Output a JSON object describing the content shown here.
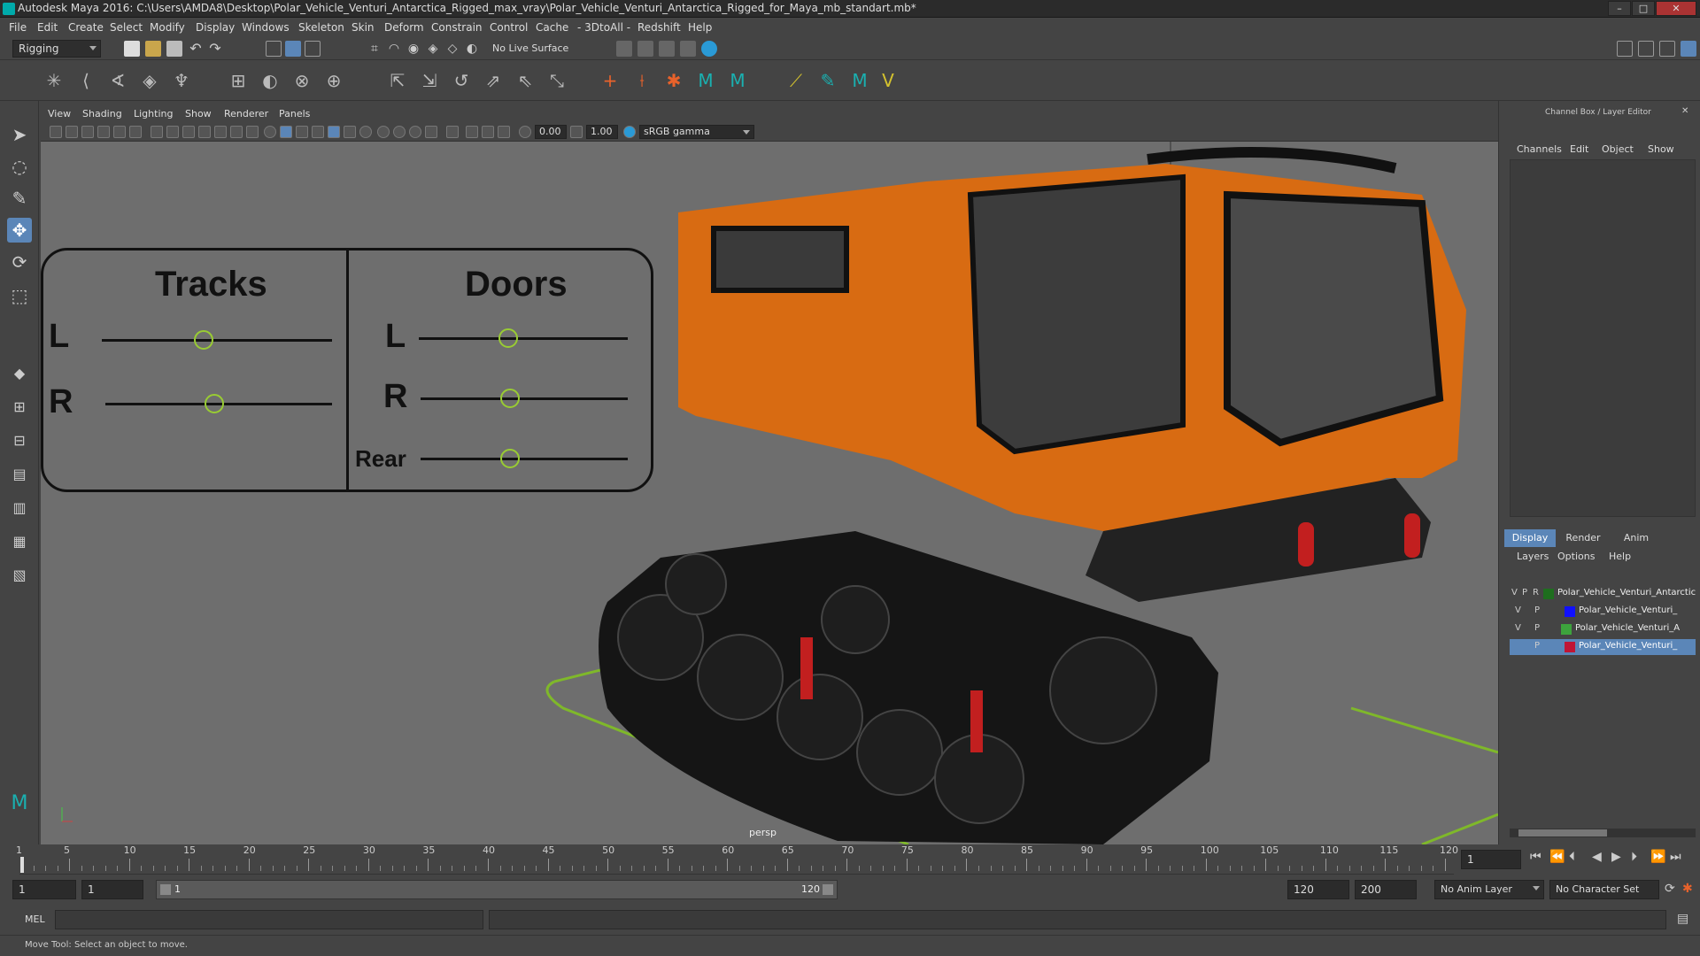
{
  "window": {
    "title": "Autodesk Maya 2016: C:\\Users\\AMDA8\\Desktop\\Polar_Vehicle_Venturi_Antarctica_Rigged_max_vray\\Polar_Vehicle_Venturi_Antarctica_Rigged_for_Maya_mb_standart.mb*",
    "minimize": "–",
    "maximize": "□",
    "close": "✕"
  },
  "menu": [
    "File",
    "Edit",
    "Create",
    "Select",
    "Modify",
    "Display",
    "Windows",
    "Skeleton",
    "Skin",
    "Deform",
    "Constrain",
    "Control",
    "Cache",
    "- 3DtoAll -",
    "Redshift",
    "Help"
  ],
  "statusline": {
    "menuset": "Rigging",
    "live_surface": "No Live Surface"
  },
  "viewport": {
    "menu": [
      "View",
      "Shading",
      "Lighting",
      "Show",
      "Renderer",
      "Panels"
    ],
    "exposure": "0.00",
    "gamma": "1.00",
    "colorspace": "sRGB gamma",
    "camera_label": "persp"
  },
  "control_panel": {
    "tracks_title": "Tracks",
    "doors_title": "Doors",
    "tracks_left": "L",
    "tracks_right": "R",
    "doors_left": "L",
    "doors_right": "R",
    "doors_rear": "Rear"
  },
  "channel_box": {
    "header": "Channel Box / Layer Editor",
    "menu": [
      "Channels",
      "Edit",
      "Object",
      "Show"
    ],
    "tabs": [
      "Display",
      "Render",
      "Anim"
    ],
    "layer_menu": [
      "Layers",
      "Options",
      "Help"
    ],
    "layers": [
      {
        "v": "V",
        "p": "P",
        "r": "R",
        "color": "#1e6e1e",
        "name": "Polar_Vehicle_Venturi_Antarctica"
      },
      {
        "v": "V",
        "p": "P",
        "r": "",
        "color": "#1010ff",
        "name": "Polar_Vehicle_Venturi_"
      },
      {
        "v": "V",
        "p": "P",
        "r": "",
        "color": "#3da33d",
        "name": "Polar_Vehicle_Venturi_A"
      },
      {
        "v": "",
        "p": "P",
        "r": "",
        "color": "#c01535",
        "name": "Polar_Vehicle_Venturi_"
      }
    ]
  },
  "timeline": {
    "ticks": [
      "1",
      "5",
      "10",
      "15",
      "20",
      "25",
      "30",
      "35",
      "40",
      "45",
      "50",
      "55",
      "60",
      "65",
      "70",
      "75",
      "80",
      "85",
      "90",
      "95",
      "100",
      "105",
      "110",
      "115",
      "120"
    ],
    "current_frame": "1"
  },
  "range": {
    "start": "1",
    "current": "1",
    "range_start": "1",
    "range_end": "120",
    "end": "120",
    "max": "200",
    "anim_layer": "No Anim Layer",
    "character_set": "No Character Set"
  },
  "cmd": {
    "label": "MEL"
  },
  "help": {
    "text": "Move Tool: Select an object to move."
  }
}
